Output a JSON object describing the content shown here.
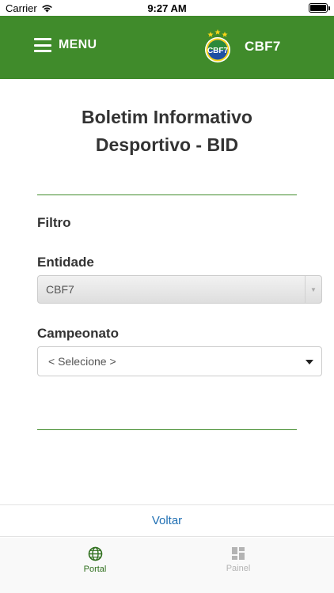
{
  "status_bar": {
    "carrier": "Carrier",
    "time": "9:27 AM",
    "icons": [
      "wifi-icon",
      "battery-icon"
    ]
  },
  "header": {
    "menu_label": "MENU",
    "brand_name": "CBF7",
    "logo_text": "CBF7",
    "colors": {
      "background": "#408b2b",
      "text": "#ffffff"
    }
  },
  "page": {
    "title_line1": "Boletim Informativo",
    "title_line2": "Desportivo - BID"
  },
  "filters": {
    "section_label": "Filtro",
    "entity": {
      "label": "Entidade",
      "selected": "CBF7"
    },
    "championship": {
      "label": "Campeonato",
      "selected": "< Selecione >"
    }
  },
  "footer": {
    "back_label": "Voltar",
    "link_color": "#1f6fb3"
  },
  "tab_bar": {
    "tabs": [
      {
        "label": "Portal",
        "icon": "globe-icon",
        "active": true
      },
      {
        "label": "Painel",
        "icon": "dashboard-icon",
        "active": false
      }
    ],
    "active_color": "#2f6f1d",
    "inactive_color": "#b4b4b4"
  }
}
